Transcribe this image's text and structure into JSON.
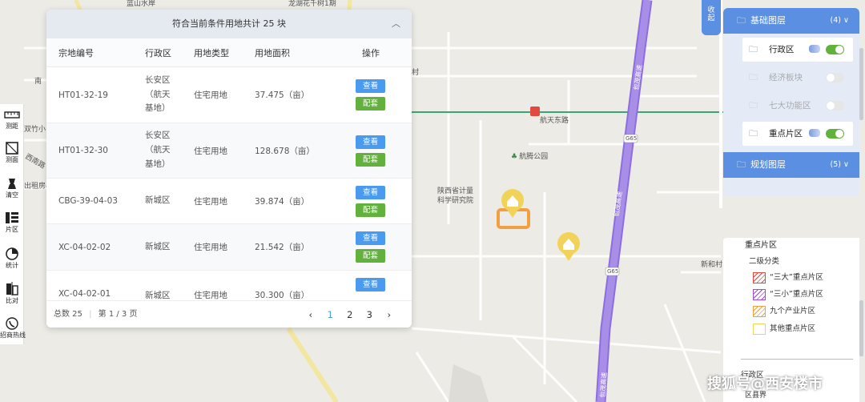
{
  "map": {
    "labels": {
      "lanshan": "蓝山水岸",
      "longhu": "龙湖花千树1期",
      "nan": "南",
      "shuangzhu": "双竹小",
      "xinan": "西南路",
      "chuzu": "出租房小",
      "cun": "村",
      "hangtian_east_road": "航天东路",
      "hangteng_park": "航腾公园",
      "metrology_institute": "陕西省计量\n科学研究院",
      "xinhe": "新和村",
      "g65_a": "G65",
      "g65_b": "G65",
      "baomao_a": "包茂高速",
      "baomao_b": "包茂高速",
      "baomao_c": "包茂高速"
    }
  },
  "toolbar": {
    "items": [
      {
        "label": "测距",
        "icon": "ruler-icon"
      },
      {
        "label": "测面",
        "icon": "area-measure-icon"
      },
      {
        "label": "清空",
        "icon": "eraser-icon"
      },
      {
        "label": "片区",
        "icon": "district-list-icon"
      },
      {
        "label": "统计",
        "icon": "pie-chart-icon"
      },
      {
        "label": "比对",
        "icon": "compare-icon"
      },
      {
        "label": "招商热线",
        "icon": "hotline-icon"
      }
    ]
  },
  "results": {
    "title": "符合当前条件用地共计 25 块",
    "columns": [
      "宗地编号",
      "行政区",
      "用地类型",
      "用地面积",
      "操作"
    ],
    "view_label": "查看",
    "match_label": "配套",
    "rows": [
      {
        "id": "HT01-32-19",
        "district": [
          "长安区",
          "（航天",
          "基地）"
        ],
        "type": "住宅用地",
        "area": "37.475（亩）"
      },
      {
        "id": "HT01-32-30",
        "district": [
          "长安区",
          "（航天",
          "基地）"
        ],
        "type": "住宅用地",
        "area": "128.678（亩）"
      },
      {
        "id": "CBG-39-04-03",
        "district": [
          "新城区"
        ],
        "type": "住宅用地",
        "area": "39.874（亩）"
      },
      {
        "id": "XC-04-02-02",
        "district": [
          "新城区"
        ],
        "type": "住宅用地",
        "area": "21.542（亩）"
      },
      {
        "id": "XC-04-02-01",
        "district": [
          "新城区"
        ],
        "type": "住宅用地",
        "area": "30.300（亩）"
      }
    ],
    "footer": {
      "total": "总数 25",
      "page_info": "第 1 / 3 页",
      "pages": [
        "1",
        "2",
        "3"
      ],
      "current_page": "1"
    }
  },
  "layers": {
    "collapse_label": [
      "收",
      "起"
    ],
    "groups": [
      {
        "name": "基础图层",
        "count": "(4)",
        "items": [
          {
            "name": "行政区",
            "on": true
          },
          {
            "name": "经济板块",
            "on": false
          },
          {
            "name": "七大功能区",
            "on": false
          },
          {
            "name": "重点片区",
            "on": true
          }
        ]
      },
      {
        "name": "规划图层",
        "count": "(5)"
      }
    ]
  },
  "legend": {
    "title": "重点片区",
    "subtitle": "二级分类",
    "items": [
      {
        "label": "“三大”重点片区",
        "color": "#e04a3f"
      },
      {
        "label": "“三小”重点片区",
        "color": "#a04ad8"
      },
      {
        "label": "九个产业片区",
        "color": "#f0a040"
      },
      {
        "label": "其他重点片区",
        "color": "#f2d35a"
      }
    ],
    "admin_title": "行政区",
    "county_label": "区县界"
  },
  "watermark": "搜狐号@西安楼市",
  "colors": {
    "accent": "#5a8fe2",
    "view_button": "#4a9bf0",
    "match_button": "#62b13d",
    "expressway": "#a98ee8",
    "metro": "#3aa676",
    "marker": "#f2d35a"
  }
}
